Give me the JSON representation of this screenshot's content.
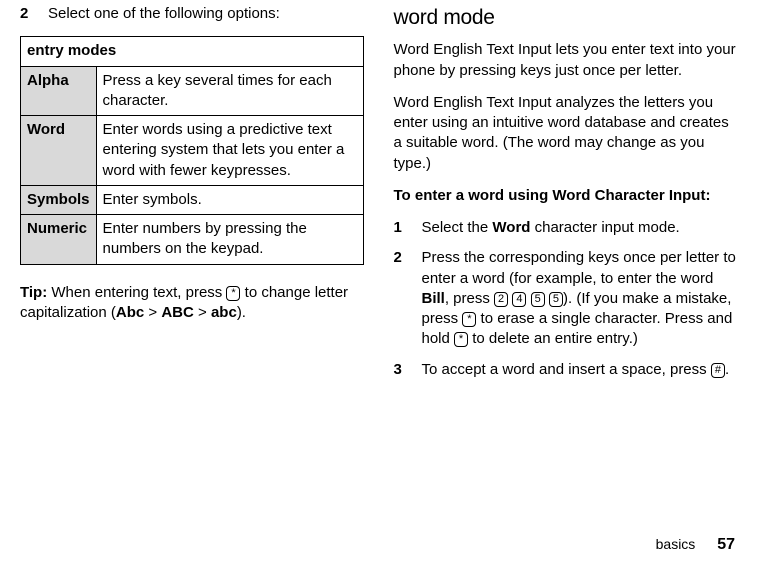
{
  "left": {
    "step2_num": "2",
    "step2_text": "Select one of the following options:",
    "table_header": "entry modes",
    "rows": [
      {
        "name": "Alpha",
        "desc": "Press a key several times for each character."
      },
      {
        "name": "Word",
        "desc": "Enter words using a predictive text entering system that lets you enter a word with fewer keypresses."
      },
      {
        "name": "Symbols",
        "desc": "Enter symbols."
      },
      {
        "name": "Numeric",
        "desc": "Enter numbers by pressing the numbers on the keypad."
      }
    ],
    "tip_label": "Tip:",
    "tip_before": " When entering text, press ",
    "tip_key": "*",
    "tip_after": " to change letter capitalization (",
    "cap1": "Abc",
    "gt1": " > ",
    "cap2": "ABC",
    "gt2": " > ",
    "cap3": "abc",
    "tip_end": ")."
  },
  "right": {
    "heading": "word mode",
    "p1": "Word English Text Input lets you enter text into your phone by pressing keys just once per letter.",
    "p2": "Word English Text Input analyzes the letters you enter using an intuitive word database and creates a suitable word. (The word may change as you type.)",
    "bold_intro": "To enter a word using Word Character Input:",
    "s1_num": "1",
    "s1_a": "Select the ",
    "s1_word": "Word",
    "s1_b": " character input mode.",
    "s2_num": "2",
    "s2_a": "Press the corresponding keys once per letter to enter a word (for example, to enter the word ",
    "s2_bill": "Bill",
    "s2_b": ", press ",
    "k2": "2",
    "k4": "4",
    "k5a": "5",
    "k5b": "5",
    "s2_c": "). (If you make a mistake, press ",
    "s2_star1": "*",
    "s2_d": " to erase a single character. Press and hold ",
    "s2_star2": "*",
    "s2_e": " to delete an entire entry.)",
    "s3_num": "3",
    "s3_a": "To accept a word and insert a space, press ",
    "s3_hash": "#",
    "s3_b": "."
  },
  "footer": {
    "section": "basics",
    "page": "57"
  }
}
